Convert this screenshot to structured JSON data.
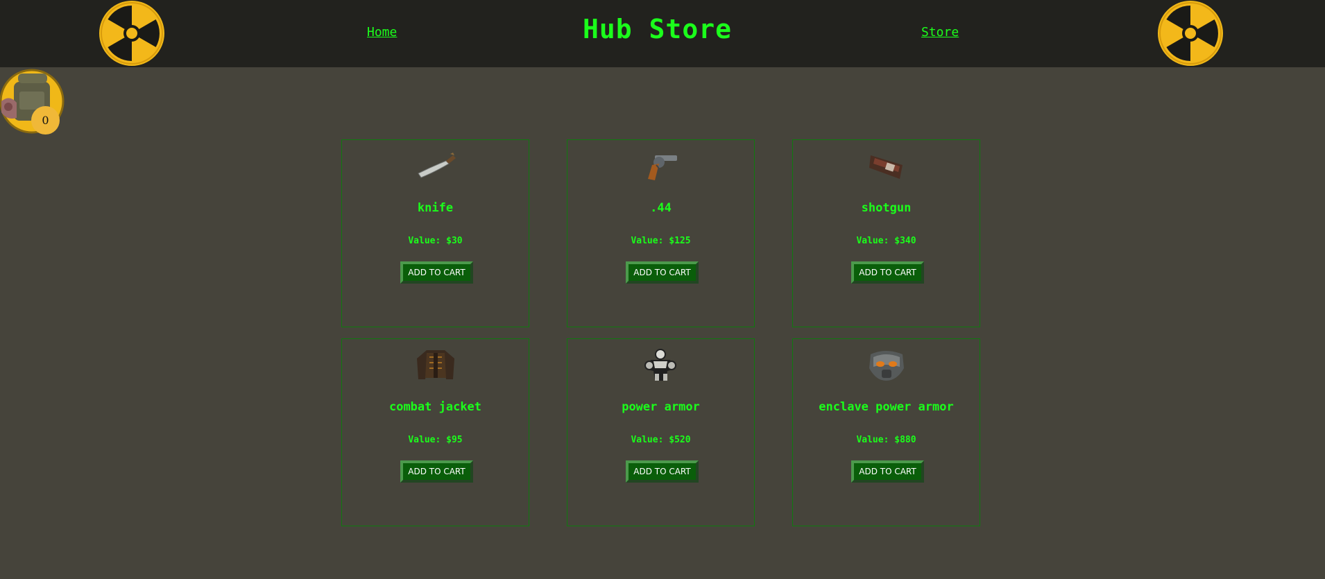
{
  "header": {
    "title": "Hub Store",
    "nav": [
      {
        "label": "Home"
      },
      {
        "label": "Store"
      }
    ]
  },
  "cart": {
    "count": "0"
  },
  "products": [
    {
      "name": "knife",
      "value": "Value: $30",
      "button": "ADD TO CART",
      "icon": "knife-icon"
    },
    {
      "name": ".44",
      "value": "Value: $125",
      "button": "ADD TO CART",
      "icon": "revolver-icon"
    },
    {
      "name": "shotgun",
      "value": "Value: $340",
      "button": "ADD TO CART",
      "icon": "shotgun-icon"
    },
    {
      "name": "combat jacket",
      "value": "Value: $95",
      "button": "ADD TO CART",
      "icon": "combat-jacket-icon"
    },
    {
      "name": "power armor",
      "value": "Value: $520",
      "button": "ADD TO CART",
      "icon": "power-armor-icon"
    },
    {
      "name": "enclave power armor",
      "value": "Value: $880",
      "button": "ADD TO CART",
      "icon": "enclave-helmet-icon"
    }
  ],
  "colors": {
    "background": "#46443b",
    "header_background": "#22221e",
    "accent_green": "#1bff1b",
    "card_border": "#0f7a0f",
    "button_green": "#0a5e0a",
    "radiation_yellow": "#f0b818",
    "badge_yellow": "#f0b838"
  }
}
